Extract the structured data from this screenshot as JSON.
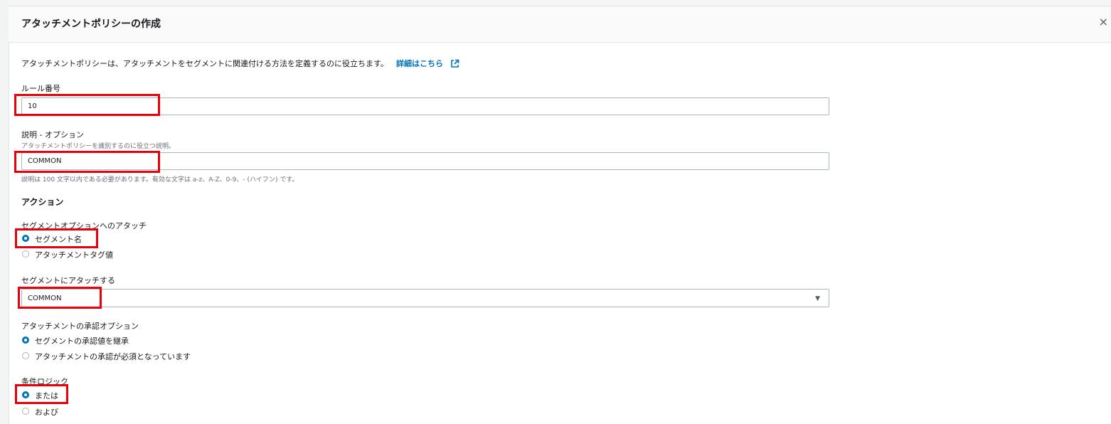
{
  "modal": {
    "title": "アタッチメントポリシーの作成",
    "close_icon": "×"
  },
  "intro": {
    "text": "アタッチメントポリシーは、アタッチメントをセグメントに関連付ける方法を定義するのに役立ちます。",
    "link_label": "詳細はこちら",
    "link_icon": "external-link-icon"
  },
  "rule_number": {
    "label": "ルール番号",
    "value": "10"
  },
  "description": {
    "label": "説明 - オプション",
    "sublabel": "アタッチメントポリシーを識別するのに役立つ説明。",
    "value": "COMMON",
    "hint": "説明は 100 文字以内である必要があります。有効な文字は a-z、A-Z、0-9、- (ハイフン) です。"
  },
  "action": {
    "heading": "アクション"
  },
  "segment_option": {
    "label": "セグメントオプションへのアタッチ",
    "options": [
      {
        "label": "セグメント名",
        "checked": true
      },
      {
        "label": "アタッチメントタグ値",
        "checked": false
      }
    ]
  },
  "attach_segment": {
    "label": "セグメントにアタッチする",
    "value": "COMMON",
    "caret": "▼"
  },
  "approval_option": {
    "label": "アタッチメントの承認オプション",
    "options": [
      {
        "label": "セグメントの承認値を継承",
        "checked": true
      },
      {
        "label": "アタッチメントの承認が必須となっています",
        "checked": false
      }
    ]
  },
  "condition_logic": {
    "label": "条件ロジック",
    "options": [
      {
        "label": "または",
        "checked": true
      },
      {
        "label": "および",
        "checked": false
      }
    ]
  },
  "colors": {
    "accent": "#0073bb",
    "highlight": "#e8000b"
  }
}
